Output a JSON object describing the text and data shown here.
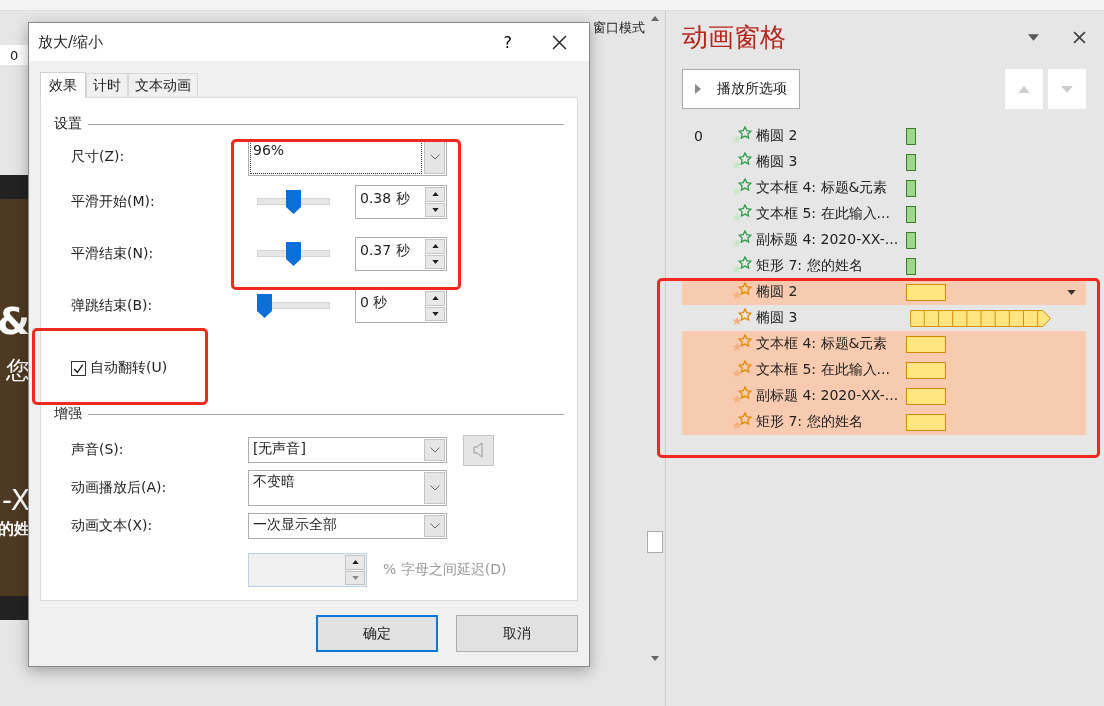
{
  "editor": {
    "view_button": "窗口模式",
    "ruler_mark": "0",
    "slide_fragments": [
      "&",
      "您",
      "-X",
      "的姓"
    ]
  },
  "dialog": {
    "title": "放大/缩小",
    "help": "?",
    "tabs": [
      {
        "label": "效果",
        "selected": true
      },
      {
        "label": "计时",
        "selected": false
      },
      {
        "label": "文本动画",
        "selected": false
      }
    ],
    "settings": {
      "heading": "设置",
      "size": {
        "label": "尺寸(Z):",
        "value": "96%"
      },
      "sliders": [
        {
          "label": "平滑开始(M):",
          "level": 0.5,
          "value": "0.38 秒"
        },
        {
          "label": "平滑结束(N):",
          "level": 0.5,
          "value": "0.37 秒"
        },
        {
          "label": "弹跳结束(B):",
          "level": 0,
          "value": "0 秒"
        }
      ],
      "auto_reverse": {
        "label": "自动翻转(U)",
        "checked": true
      }
    },
    "enhance": {
      "heading": "增强",
      "fields": [
        {
          "label": "声音(S):",
          "value": "[无声音]"
        },
        {
          "label": "动画播放后(A):",
          "value": "不变暗"
        },
        {
          "label": "动画文本(X):",
          "value": "一次显示全部"
        }
      ],
      "delay": {
        "label": "% 字母之间延迟(D)",
        "disabled": true
      }
    },
    "buttons": [
      {
        "label": "确定",
        "default": true
      },
      {
        "label": "取消",
        "default": false
      }
    ]
  },
  "pane": {
    "title": "动画窗格",
    "play_button": "播放所选项",
    "items": [
      {
        "step": "0",
        "label": "椭圆 2",
        "kind": "entrance",
        "selected": false,
        "bar": {
          "kind": "short"
        },
        "menu": false
      },
      {
        "label": "椭圆 3",
        "kind": "entrance",
        "selected": false,
        "bar": {
          "kind": "short"
        },
        "menu": false
      },
      {
        "label": "文本框 4: 标题&元素",
        "kind": "entrance",
        "selected": false,
        "bar": {
          "kind": "short"
        },
        "menu": false
      },
      {
        "label": "文本框 5: 在此输入...",
        "kind": "entrance",
        "selected": false,
        "bar": {
          "kind": "short"
        },
        "menu": false
      },
      {
        "label": "副标题 4: 2020-XX-...",
        "kind": "entrance",
        "selected": false,
        "bar": {
          "kind": "short"
        },
        "menu": false
      },
      {
        "label": "矩形 7: 您的姓名",
        "kind": "entrance",
        "selected": false,
        "bar": {
          "kind": "short"
        },
        "menu": false
      },
      {
        "label": "椭圆 2",
        "kind": "emphasis",
        "selected": true,
        "bar": {
          "kind": "short"
        },
        "menu": true
      },
      {
        "label": "椭圆 3",
        "kind": "emphasis",
        "selected": false,
        "bar": {
          "kind": "long"
        },
        "menu": false
      },
      {
        "label": "文本框 4: 标题&元素",
        "kind": "emphasis",
        "selected": true,
        "bar": {
          "kind": "short"
        },
        "menu": false
      },
      {
        "label": "文本框 5: 在此输入...",
        "kind": "emphasis",
        "selected": true,
        "bar": {
          "kind": "short"
        },
        "menu": false
      },
      {
        "label": "副标题 4: 2020-XX-...",
        "kind": "emphasis",
        "selected": true,
        "bar": {
          "kind": "short"
        },
        "menu": false
      },
      {
        "label": "矩形 7: 您的姓名",
        "kind": "emphasis",
        "selected": true,
        "bar": {
          "kind": "short"
        },
        "menu": false
      }
    ]
  }
}
